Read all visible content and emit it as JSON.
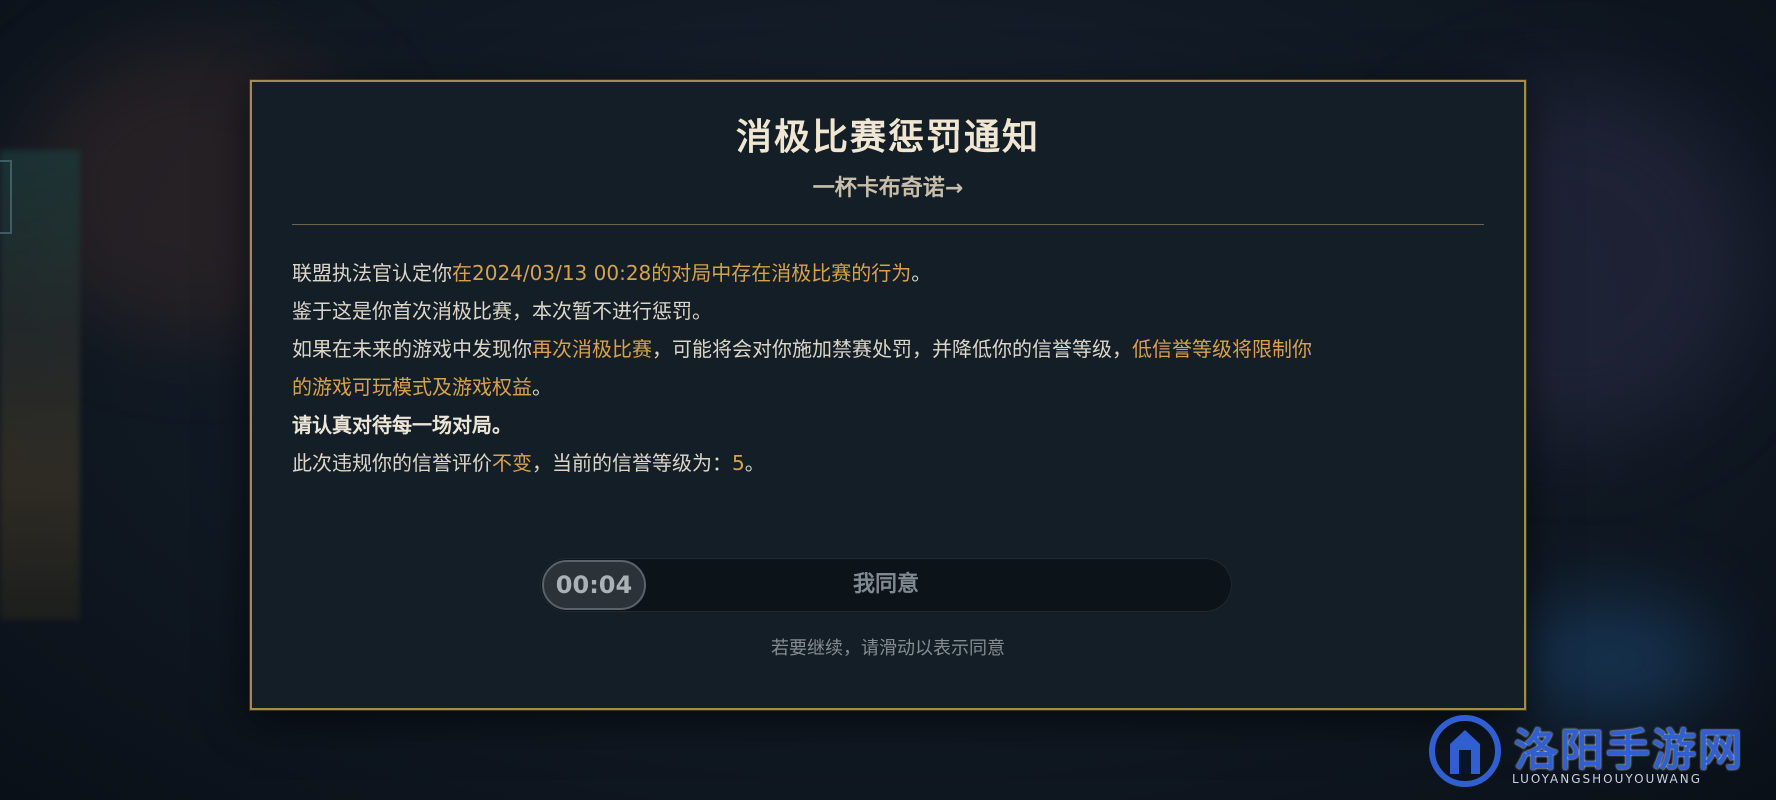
{
  "dialog": {
    "title": "消极比赛惩罚通知",
    "subtitle": "一杯卡布奇诺→",
    "lines": [
      {
        "segments": [
          {
            "text": "联盟执法官认定你",
            "style": "normal"
          },
          {
            "text": "在2024/03/13 00:28的对局中存在消极比赛的行为",
            "style": "highlight"
          },
          {
            "text": "。",
            "style": "normal"
          }
        ]
      },
      {
        "segments": [
          {
            "text": "鉴于这是你首次消极比赛，本次暂不进行惩罚。",
            "style": "normal"
          }
        ]
      },
      {
        "segments": [
          {
            "text": "如果在未来的游戏中发现你",
            "style": "normal"
          },
          {
            "text": "再次消极比赛",
            "style": "highlight"
          },
          {
            "text": "，可能将会对你施加禁赛处罚，并降低你的信誉等级，",
            "style": "normal"
          },
          {
            "text": "低信誉等级将限制你",
            "style": "highlight"
          }
        ]
      },
      {
        "segments": [
          {
            "text": "的游戏可玩模式及游戏权益",
            "style": "highlight"
          },
          {
            "text": "。",
            "style": "normal"
          }
        ]
      },
      {
        "segments": [
          {
            "text": "请认真对待每一场对局。",
            "style": "strong"
          }
        ]
      },
      {
        "segments": [
          {
            "text": "此次违规你的信誉评价",
            "style": "normal"
          },
          {
            "text": "不变",
            "style": "highlight"
          },
          {
            "text": "，当前的信誉等级为：",
            "style": "normal"
          },
          {
            "text": "5",
            "style": "highlight"
          },
          {
            "text": "。",
            "style": "normal"
          }
        ]
      }
    ],
    "slider": {
      "timer": "00:04",
      "label": "我同意"
    },
    "hint": "若要继续，请滑动以表示同意"
  },
  "watermark": {
    "name": "洛阳手游网",
    "sub": "LUOYANGSHOUYOUWANG"
  },
  "colors": {
    "highlight": "#d8a24b",
    "border": "#a58a4c",
    "modal_bg": "#131e26"
  }
}
